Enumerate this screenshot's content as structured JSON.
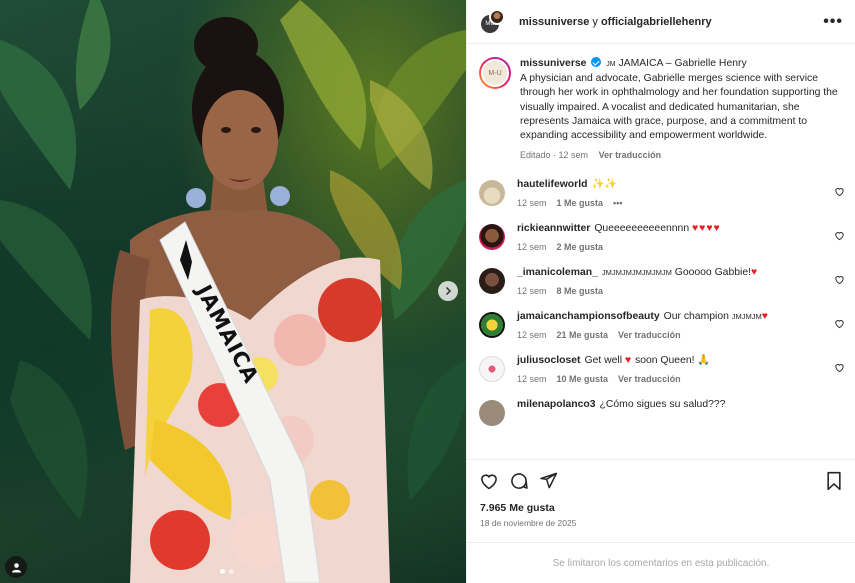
{
  "post": {
    "header": {
      "user1": "missuniverse",
      "separator": " y ",
      "user2": "officialgabriellehenry",
      "more_label": "•••"
    },
    "media": {
      "sash_text": "JAMAICA",
      "dots_count": 2
    },
    "caption": {
      "avatar_text": "M◦U",
      "user": "missuniverse",
      "country_code": "JM",
      "title": "JAMAICA – Gabrielle Henry",
      "text": "A physician and advocate, Gabrielle merges science with service through her work in ophthalmology and her foundation supporting the visually impaired. A vocalist and dedicated humanitarian, she represents Jamaica with grace, purpose, and a commitment to expanding accessibility and empowerment worldwide.",
      "edited": "Editado · 12 sem",
      "translate": "Ver traducción"
    },
    "comments": [
      {
        "user": "hautelifeworld",
        "text": "✨✨",
        "time": "12 sem",
        "likes": "1 Me gusta",
        "extra": "•••",
        "color": "#c9b79a"
      },
      {
        "user": "rickieannwitter",
        "text": "Queeeeeeeeeennnn",
        "emoji": "♥♥♥♥",
        "time": "12 sem",
        "likes": "2 Me gusta",
        "extra": "",
        "color": "#6b2b2b"
      },
      {
        "user": "_imanicoleman_",
        "text_small": "JMJMJMJMJMJMJM",
        "text": "Gooooo Gabbie!",
        "emoji": "♥",
        "time": "12 sem",
        "likes": "8 Me gusta",
        "extra": "",
        "color": "#4a3a32"
      },
      {
        "user": "jamaicanchampionsofbeauty",
        "text": "Our champion",
        "text_small": "JMJMJM",
        "emoji": "♥",
        "time": "12 sem",
        "likes": "21 Me gusta",
        "extra": "Ver traducción",
        "color": "#2e7d32"
      },
      {
        "user": "juliusocloset",
        "text": "Get well",
        "emoji": "♥",
        "text2": "soon Queen! 🙏",
        "time": "12 sem",
        "likes": "10 Me gusta",
        "extra": "Ver traducción",
        "color": "#cfcfcf"
      },
      {
        "user": "milenapolanco3",
        "text": "¿Cómo sigues su salud???",
        "time": "",
        "likes": "",
        "extra": "",
        "color": "#9a8a7a"
      }
    ],
    "likes_count": "7.965 Me gusta",
    "date": "18 de noviembre de 2025",
    "comments_closed": "Se limitaron los comentarios en esta publicación."
  },
  "colors": {
    "verified": "#0095f6",
    "heart_red": "#ed1c24",
    "muted_text": "#737373"
  }
}
